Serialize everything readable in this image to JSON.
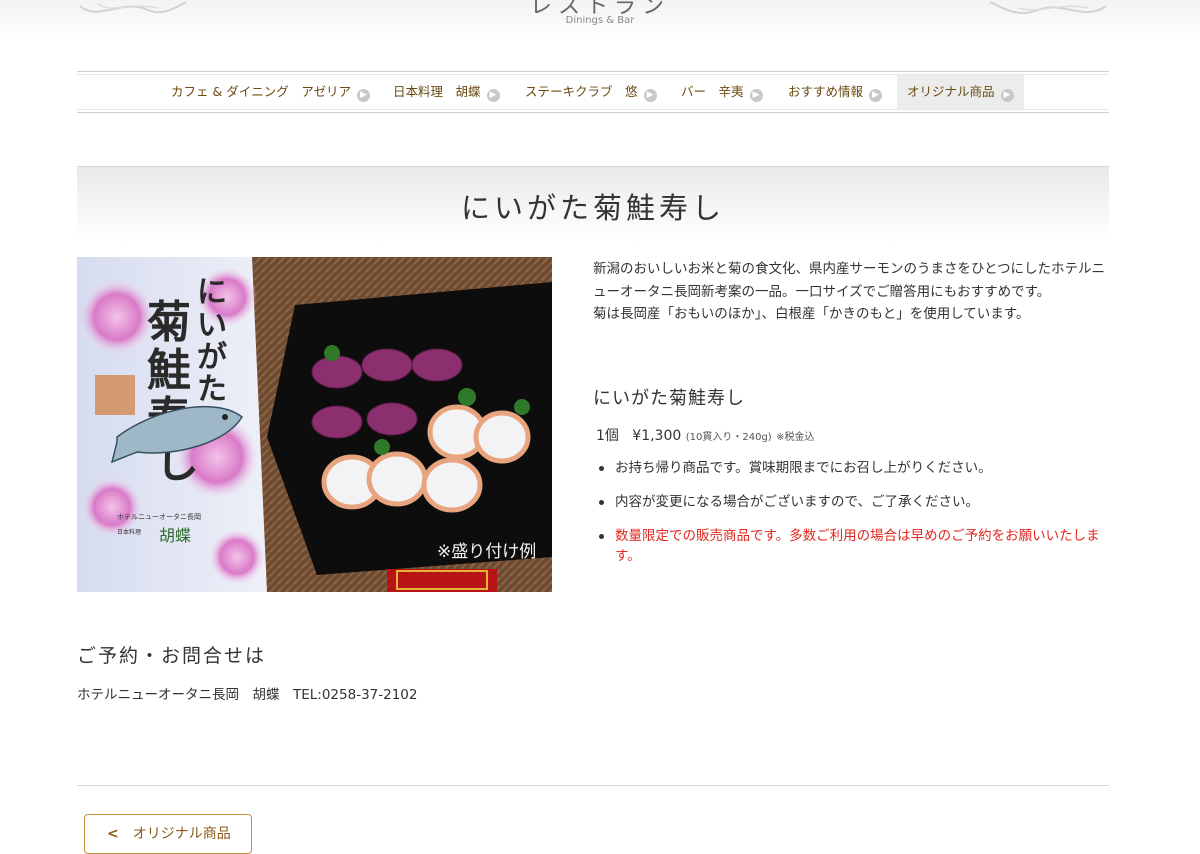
{
  "header": {
    "title": "レストラン",
    "subtitle": "Dinings & Bar"
  },
  "nav": {
    "items": [
      {
        "label": "カフェ & ダイニング　アゼリア"
      },
      {
        "label": "日本料理　胡蝶"
      },
      {
        "label": "ステーキクラブ　悠"
      },
      {
        "label": "バー　辛夷"
      },
      {
        "label": "おすすめ情報"
      },
      {
        "label": "オリジナル商品"
      }
    ],
    "active_index": 5,
    "arrow_icon": "chevron-right-circle-icon"
  },
  "page": {
    "title": "にいがた菊鮭寿し"
  },
  "photo": {
    "package_title": "にいがた菊鮭寿し",
    "brand_small": "ホテルニューオータニ長岡",
    "restaurant_small": "日本料理",
    "restaurant_name": "胡蝶",
    "caption": "※盛り付け例"
  },
  "description": {
    "line1": "新潟のおいしいお米と菊の食文化、県内産サーモンのうまさをひとつにしたホテルニューオータニ長岡新考案の一品。一口サイズでご贈答用にもおすすめです。",
    "line2": "菊は長岡産「おもいのほか」、白根産「かきのもと」を使用しています。"
  },
  "product": {
    "name": "にいがた菊鮭寿し",
    "quantity": "1個",
    "price": "¥1,300",
    "detail": "(10貫入り・240g)",
    "tax": "※税金込",
    "notes": [
      {
        "text": "お持ち帰り商品です。賞味期限までにお召し上がりください。",
        "warning": false
      },
      {
        "text": "内容が変更になる場合がございますので、ご了承ください。",
        "warning": false
      },
      {
        "text": "数量限定での販売商品です。多数ご利用の場合は早めのご予約をお願いいたします。",
        "warning": true
      }
    ]
  },
  "contact": {
    "heading": "ご予約・お問合せは",
    "text": "ホテルニューオータニ長岡　胡蝶　TEL:0258-37-2102"
  },
  "footer": {
    "back_label": "オリジナル商品",
    "back_icon": "chevron-left-icon"
  },
  "colors": {
    "nav_text": "#6b4a12",
    "warning": "#e0281f",
    "button_border": "#c8913d"
  }
}
